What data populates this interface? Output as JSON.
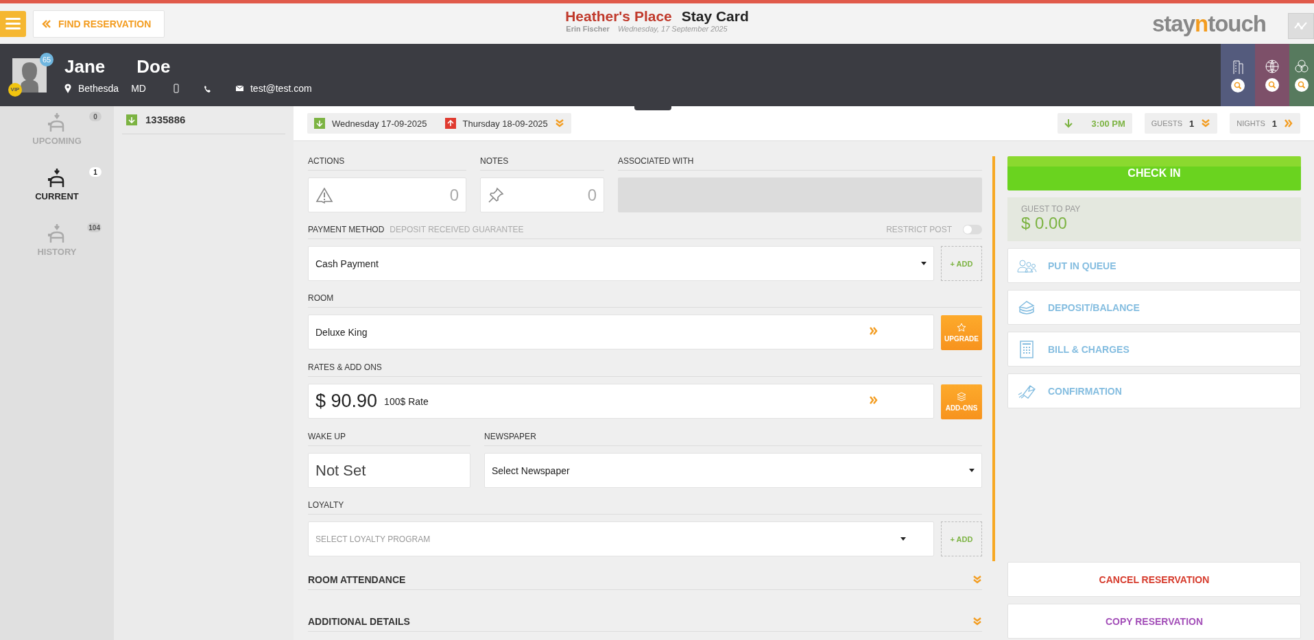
{
  "top_bar": {
    "find_button": "FIND RESERVATION",
    "hotel": "Heather's Place",
    "page_title": "Stay Card",
    "user": "Erin Fischer",
    "date": "Wednesday, 17 September 2025",
    "logo": [
      {
        "text": "stay",
        "accent": false
      },
      {
        "text": "n",
        "accent": true
      },
      {
        "text": "touch",
        "accent": false
      }
    ]
  },
  "guest": {
    "first_name": "Jane",
    "last_name": "Doe",
    "badge": "65",
    "vip": "VIP",
    "city": "Bethesda",
    "state": "MD",
    "email": "test@test.com"
  },
  "header_tiles": [
    {
      "kind": "building",
      "color": "#545b7d"
    },
    {
      "kind": "globe",
      "color": "#7d5069"
    },
    {
      "kind": "circles",
      "color": "#577a5e"
    }
  ],
  "timeline": [
    {
      "label": "UPCOMING",
      "count": "0",
      "selected": false
    },
    {
      "label": "CURRENT",
      "count": "1",
      "selected": true
    },
    {
      "label": "HISTORY",
      "count": "104",
      "selected": false
    }
  ],
  "reservations": [
    {
      "number": "1335886"
    }
  ],
  "stay_dates": {
    "arrival": "Wednesday 17-09-2025",
    "departure": "Thursday 18-09-2025",
    "arrival_time": "3:00 PM",
    "guests_label": "GUESTS",
    "guests": "1",
    "nights_label": "NIGHTS",
    "nights": "1"
  },
  "form": {
    "actions_label": "ACTIONS",
    "actions_count": "0",
    "notes_label": "NOTES",
    "notes_count": "0",
    "associated_label": "ASSOCIATED WITH",
    "payment_label": "PAYMENT METHOD",
    "payment_note": "DEPOSIT RECEIVED GUARANTEE",
    "restrict_label": "RESTRICT POST",
    "restrict_on": false,
    "payment_value": "Cash Payment",
    "add_button": "+ ADD",
    "room_label": "ROOM",
    "room_value": "Deluxe King",
    "upgrade_button": "UPGRADE",
    "rates_label": "RATES & ADD ONS",
    "rate_amount": "$ 90.90",
    "rate_name": "100$ Rate",
    "addons_button": "ADD-ONS",
    "wakeup_label": "WAKE UP",
    "wakeup_value": "Not Set",
    "newspaper_label": "NEWSPAPER",
    "newspaper_value": "Select Newspaper",
    "loyalty_label": "LOYALTY",
    "loyalty_placeholder": "SELECT LOYALTY PROGRAM",
    "loyalty_add": "+ ADD",
    "sections": [
      "ROOM ATTENDANCE",
      "ADDITIONAL DETAILS"
    ]
  },
  "side_panel": {
    "check_in": "CHECK IN",
    "balance_label": "GUEST TO PAY",
    "balance": "$ 0.00",
    "actions": [
      {
        "kind": "queue",
        "label": "PUT IN QUEUE"
      },
      {
        "kind": "deposit",
        "label": "DEPOSIT/BALANCE"
      },
      {
        "kind": "bill",
        "label": "BILL & CHARGES"
      },
      {
        "kind": "confirmation",
        "label": "CONFIRMATION"
      }
    ],
    "cancel": "CANCEL RESERVATION",
    "copy": "COPY RESERVATION"
  }
}
